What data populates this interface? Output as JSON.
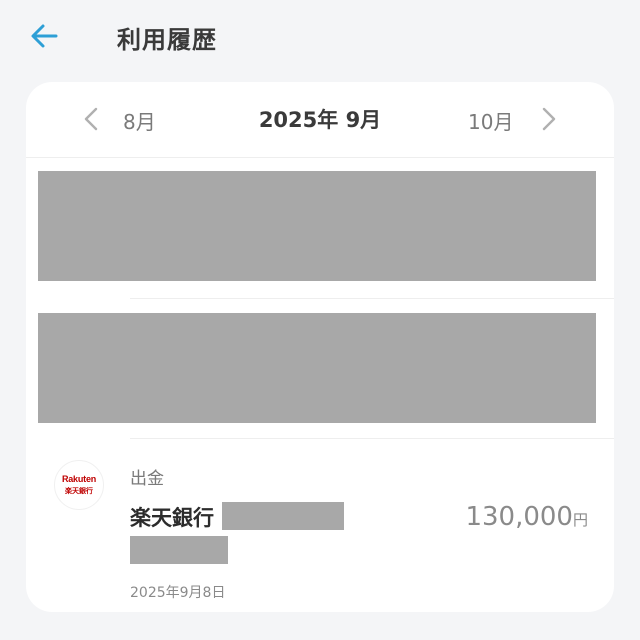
{
  "header": {
    "title": "利用履歴",
    "back_icon": "arrow-left-icon",
    "accent_color": "#2d9fd6"
  },
  "month_nav": {
    "prev_label": "8月",
    "current_label": "2025年 9月",
    "next_label": "10月",
    "prev_icon": "chevron-left-icon",
    "next_icon": "chevron-right-icon"
  },
  "transactions": [
    {
      "type": "出金",
      "name": "楽天銀行",
      "amount": "130,000",
      "currency_unit": "円",
      "date": "2025年9月8日",
      "logo": {
        "icon": "rakuten-bank-logo-icon",
        "text_top": "Rakuten",
        "text_bottom": "楽天銀行",
        "color": "#bf0000"
      }
    }
  ],
  "redaction_color": "#a8a8a8"
}
